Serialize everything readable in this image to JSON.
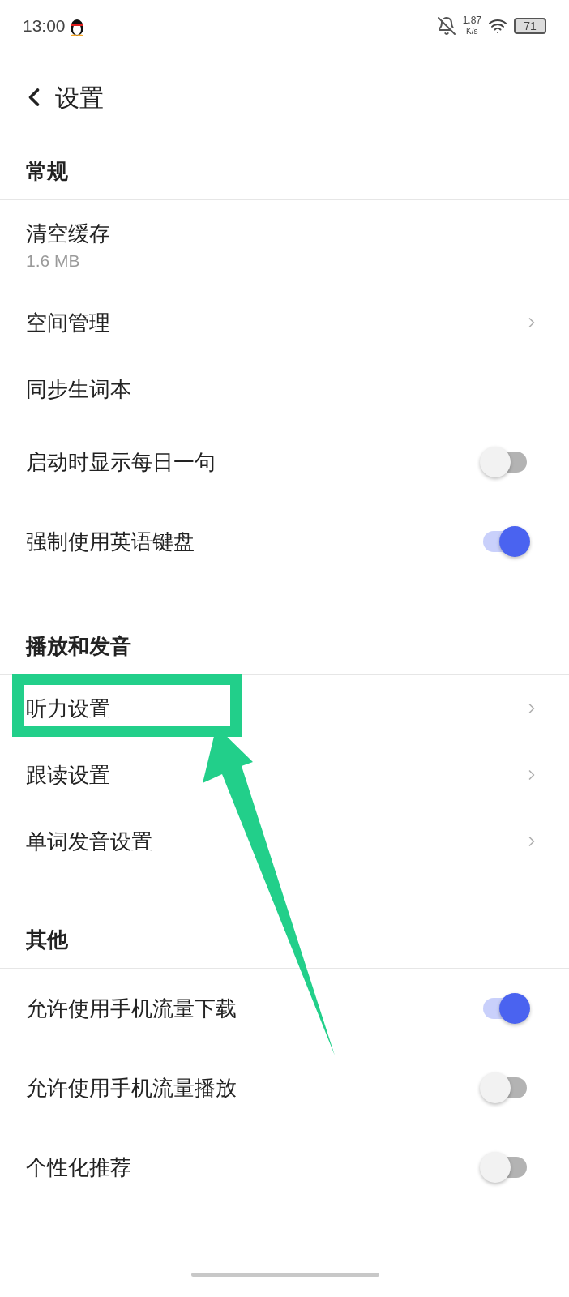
{
  "status_bar": {
    "time": "13:00",
    "speed": "1.87",
    "speed_unit": "K/s",
    "battery": "71"
  },
  "header": {
    "title": "设置"
  },
  "sections": [
    {
      "title": "常规",
      "items": [
        {
          "kind": "value",
          "label": "清空缓存",
          "value": "1.6 MB"
        },
        {
          "kind": "link",
          "label": "空间管理"
        },
        {
          "kind": "plain",
          "label": "同步生词本"
        },
        {
          "kind": "toggle",
          "label": "启动时显示每日一句",
          "on": false
        },
        {
          "kind": "toggle",
          "label": "强制使用英语键盘",
          "on": true
        }
      ]
    },
    {
      "title": "播放和发音",
      "items": [
        {
          "kind": "link",
          "label": "听力设置"
        },
        {
          "kind": "link",
          "label": "跟读设置"
        },
        {
          "kind": "link",
          "label": "单词发音设置"
        }
      ]
    },
    {
      "title": "其他",
      "items": [
        {
          "kind": "toggle",
          "label": "允许使用手机流量下载",
          "on": true
        },
        {
          "kind": "toggle",
          "label": "允许使用手机流量播放",
          "on": false
        },
        {
          "kind": "toggle",
          "label": "个性化推荐",
          "on": false
        }
      ]
    }
  ]
}
